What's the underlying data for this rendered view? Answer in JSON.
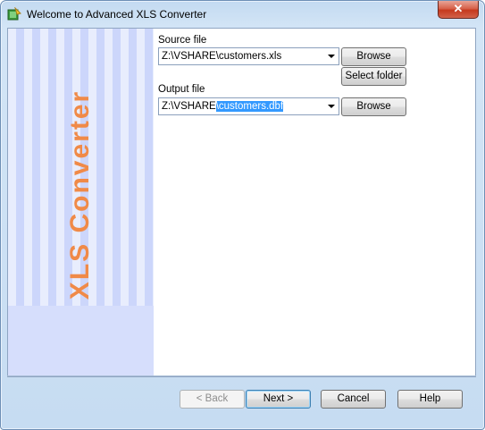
{
  "window": {
    "title": "Welcome to Advanced XLS Converter",
    "close_glyph": "✕"
  },
  "banner": {
    "text": "XLS Converter",
    "accent": "#f08a48"
  },
  "source": {
    "label": "Source file",
    "value": "Z:\\VSHARE\\customers.xls",
    "browse_label": "Browse",
    "select_folder_label": "Select folder"
  },
  "output": {
    "label": "Output file",
    "value_prefix": "Z:\\VSHARE",
    "value_selected": "\\customers.dbf",
    "browse_label": "Browse"
  },
  "footer": {
    "back_label": "< Back",
    "next_label": "Next >",
    "cancel_label": "Cancel",
    "help_label": "Help"
  }
}
